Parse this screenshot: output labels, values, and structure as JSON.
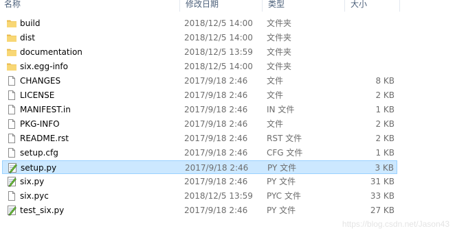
{
  "columns": {
    "name": "名称",
    "date": "修改日期",
    "type": "类型",
    "size": "大小"
  },
  "files": [
    {
      "name": "build",
      "date": "2018/12/5 14:00",
      "type": "文件夹",
      "size": "",
      "icon": "folder-icon"
    },
    {
      "name": "dist",
      "date": "2018/12/5 14:00",
      "type": "文件夹",
      "size": "",
      "icon": "folder-icon"
    },
    {
      "name": "documentation",
      "date": "2018/12/5 13:59",
      "type": "文件夹",
      "size": "",
      "icon": "folder-icon"
    },
    {
      "name": "six.egg-info",
      "date": "2018/12/5 14:00",
      "type": "文件夹",
      "size": "",
      "icon": "folder-icon"
    },
    {
      "name": "CHANGES",
      "date": "2017/9/18 2:46",
      "type": "文件",
      "size": "8 KB",
      "icon": "file-icon"
    },
    {
      "name": "LICENSE",
      "date": "2017/9/18 2:46",
      "type": "文件",
      "size": "2 KB",
      "icon": "file-icon"
    },
    {
      "name": "MANIFEST.in",
      "date": "2017/9/18 2:46",
      "type": "IN 文件",
      "size": "1 KB",
      "icon": "file-icon"
    },
    {
      "name": "PKG-INFO",
      "date": "2017/9/18 2:46",
      "type": "文件",
      "size": "2 KB",
      "icon": "file-icon"
    },
    {
      "name": "README.rst",
      "date": "2017/9/18 2:46",
      "type": "RST 文件",
      "size": "2 KB",
      "icon": "file-icon"
    },
    {
      "name": "setup.cfg",
      "date": "2017/9/18 2:46",
      "type": "CFG 文件",
      "size": "1 KB",
      "icon": "file-icon"
    },
    {
      "name": "setup.py",
      "date": "2017/9/18 2:46",
      "type": "PY 文件",
      "size": "3 KB",
      "icon": "python-file-icon",
      "selected": true
    },
    {
      "name": "six.py",
      "date": "2017/9/18 2:46",
      "type": "PY 文件",
      "size": "31 KB",
      "icon": "python-file-icon"
    },
    {
      "name": "six.pyc",
      "date": "2018/12/5 13:59",
      "type": "PYC 文件",
      "size": "33 KB",
      "icon": "file-icon"
    },
    {
      "name": "test_six.py",
      "date": "2017/9/18 2:46",
      "type": "PY 文件",
      "size": "27 KB",
      "icon": "python-file-icon"
    }
  ],
  "watermark": "https://blog.csdn.net/Jason43",
  "colors": {
    "selection_bg": "#cce8ff",
    "selection_border": "#99d1ff",
    "folder": "#f8d775",
    "header_text": "#4c607a",
    "secondary_text": "#6d6d6d"
  }
}
